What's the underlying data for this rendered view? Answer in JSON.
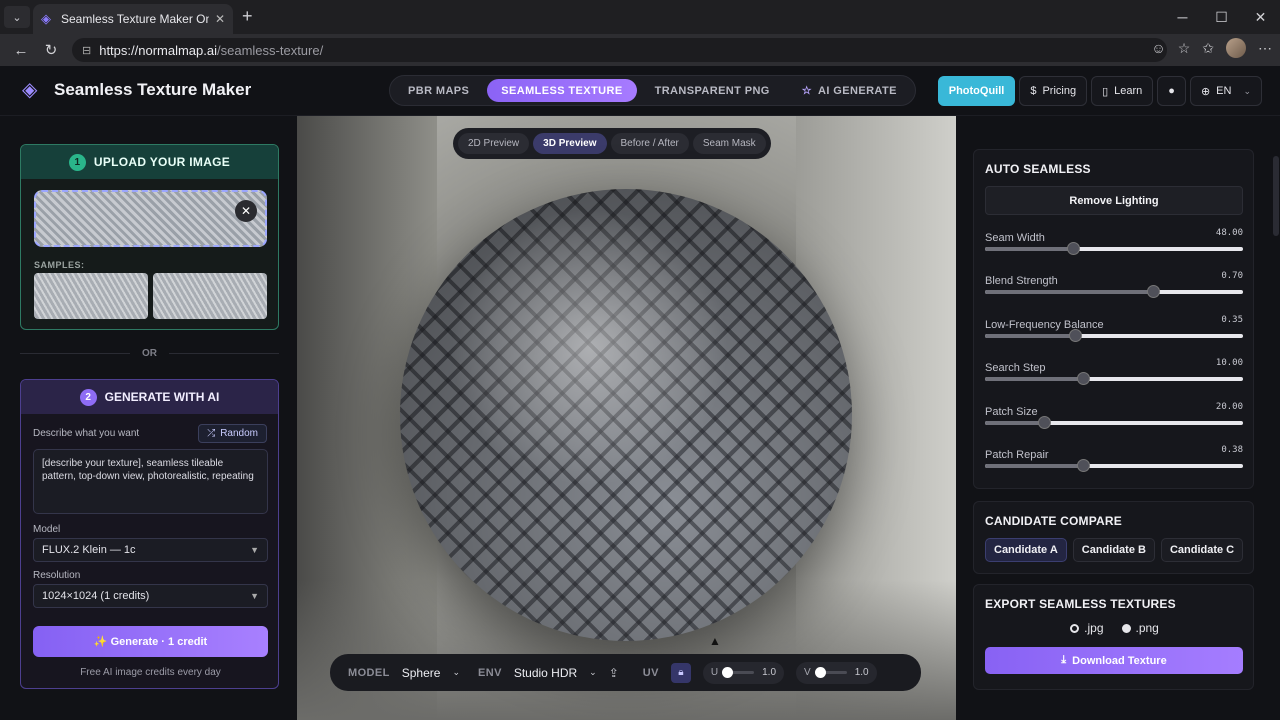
{
  "browser": {
    "tab_title": "Seamless Texture Maker Online &",
    "url_host": "https://normalmap.ai",
    "url_path": "/seamless-texture/"
  },
  "header": {
    "brand": "Seamless Texture Maker",
    "modes": [
      {
        "label": "PBR MAPS",
        "active": false
      },
      {
        "label": "SEAMLESS TEXTURE",
        "active": true
      },
      {
        "label": "TRANSPARENT PNG",
        "active": false
      },
      {
        "label": "AI GENERATE",
        "active": false
      }
    ],
    "photoquill": "PhotoQuill",
    "pricing": "Pricing",
    "learn": "Learn",
    "lang": "EN"
  },
  "upload_card": {
    "step": "1",
    "title": "UPLOAD YOUR IMAGE",
    "samples_label": "SAMPLES:"
  },
  "or_label": "OR",
  "ai_card": {
    "step": "2",
    "title": "GENERATE WITH AI",
    "describe_label": "Describe what you want",
    "random_label": "Random",
    "prompt": "[describe your texture], seamless tileable pattern, top-down view, photorealistic, repeating",
    "model_label": "Model",
    "model_value": "FLUX.2 Klein — 1c",
    "resolution_label": "Resolution",
    "resolution_value": "1024×1024 (1 credits)",
    "generate_label": "✨ Generate · 1 credit",
    "free_note": "Free AI image credits every day"
  },
  "preview": {
    "tabs": [
      {
        "label": "2D Preview",
        "active": false
      },
      {
        "label": "3D Preview",
        "active": true
      },
      {
        "label": "Before / After",
        "active": false
      },
      {
        "label": "Seam Mask",
        "active": false
      }
    ],
    "model_label": "MODEL",
    "model_value": "Sphere",
    "env_label": "ENV",
    "env_value": "Studio HDR",
    "uv_label": "UV",
    "u_label": "U",
    "u_value": "1.0",
    "v_label": "V",
    "v_value": "1.0"
  },
  "auto_seamless": {
    "title": "AUTO SEAMLESS",
    "remove_lighting": "Remove Lighting",
    "sliders": [
      {
        "name": "Seam Width",
        "value": "48.00",
        "fraction": 0.34
      },
      {
        "name": "Blend Strength",
        "value": "0.70",
        "fraction": 0.65
      },
      {
        "name": "Low-Frequency Balance",
        "value": "0.35",
        "fraction": 0.35
      },
      {
        "name": "Search Step",
        "value": "10.00",
        "fraction": 0.38
      },
      {
        "name": "Patch Size",
        "value": "20.00",
        "fraction": 0.23
      },
      {
        "name": "Patch Repair",
        "value": "0.38",
        "fraction": 0.38
      }
    ]
  },
  "candidates": {
    "title": "CANDIDATE COMPARE",
    "items": [
      {
        "label": "Candidate A",
        "active": true
      },
      {
        "label": "Candidate B",
        "active": false
      },
      {
        "label": "Candidate C",
        "active": false
      }
    ]
  },
  "export": {
    "title": "EXPORT SEAMLESS TEXTURES",
    "formats": [
      {
        "label": ".jpg",
        "selected": false
      },
      {
        "label": ".png",
        "selected": false
      }
    ],
    "download_label": "Download Texture"
  }
}
